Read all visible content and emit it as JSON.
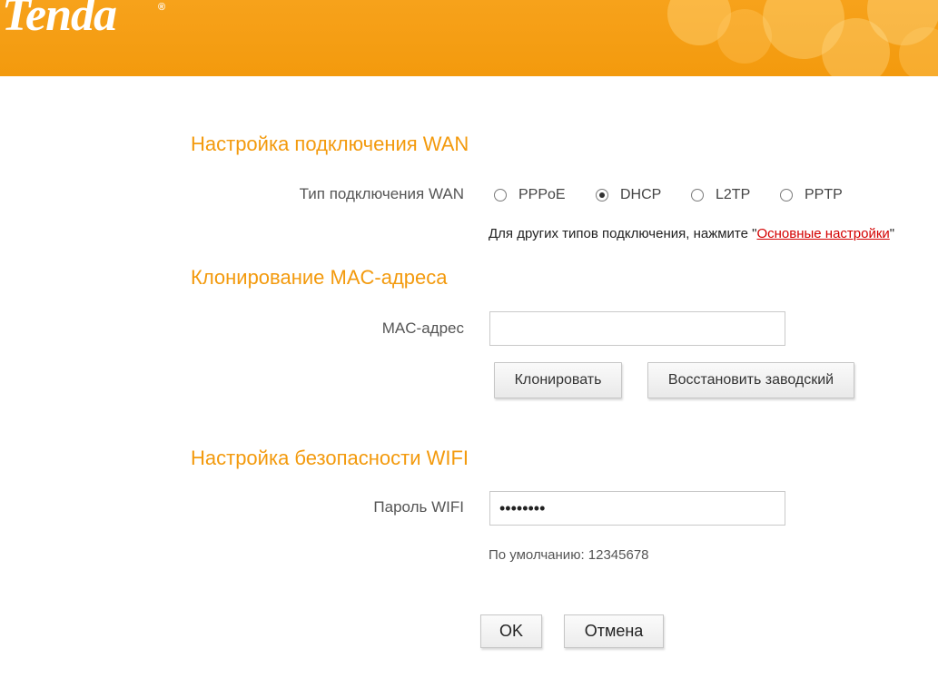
{
  "brand": {
    "logo_text": "Tenda",
    "registered_mark": "®"
  },
  "colors": {
    "header_orange": "#f39a0d",
    "title_orange": "#f39a0d",
    "link_red": "#d40000"
  },
  "wan": {
    "title": "Настройка подключения WAN",
    "type_label": "Тип подключения WAN",
    "options": [
      {
        "label": "PPPoE",
        "checked": false
      },
      {
        "label": "DHCP",
        "checked": true
      },
      {
        "label": "L2TP",
        "checked": false
      },
      {
        "label": "PPTP",
        "checked": false
      }
    ],
    "note_prefix": "Для других типов подключения, нажмите \"",
    "note_link": "Основные настройки",
    "note_suffix": "\""
  },
  "mac": {
    "title": "Клонирование MAC-адреса",
    "field_label": "MAC-адрес",
    "field_value": "",
    "clone_button": "Клонировать",
    "restore_button": "Восстановить заводский"
  },
  "wifi": {
    "title": "Настройка безопасности WIFI",
    "password_label": "Пароль WIFI",
    "password_value": "12345678",
    "default_hint": "По умолчанию: 12345678"
  },
  "actions": {
    "ok": "OK",
    "cancel": "Отмена"
  }
}
